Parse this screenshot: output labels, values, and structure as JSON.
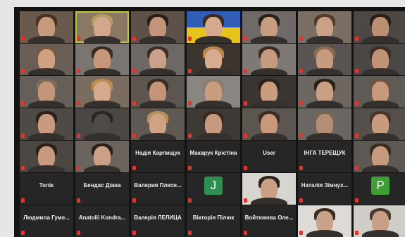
{
  "meeting": {
    "rows": [
      [
        {
          "kind": "video",
          "label": "",
          "skin": "#c49a7b",
          "hair": "#4a3023",
          "bg": "#6a5a4e",
          "active": false
        },
        {
          "kind": "video",
          "label": "",
          "skin": "#d2a88d",
          "hair": "#b59a63",
          "bg": "#8a7862",
          "active": true
        },
        {
          "kind": "video",
          "label": "",
          "skin": "#c39479",
          "hair": "#2b1e18",
          "bg": "#5d5149",
          "active": false
        },
        {
          "kind": "flag",
          "label": "",
          "skin": "#d4a990",
          "hair": "#3a2a22",
          "bg": "#2f5db7",
          "active": false
        },
        {
          "kind": "video",
          "label": "",
          "skin": "#c79c80",
          "hair": "#2a201b",
          "bg": "#6f6a67",
          "active": false
        },
        {
          "kind": "video",
          "label": "",
          "skin": "#caa088",
          "hair": "#55392a",
          "bg": "#7b6f63",
          "active": false
        },
        {
          "kind": "video",
          "label": "",
          "skin": "#bc8f73",
          "hair": "#2a2019",
          "bg": "#4e4844",
          "active": false
        }
      ],
      [
        {
          "kind": "video",
          "label": "",
          "skin": "#d0a083",
          "hair": "#7a5a3f",
          "bg": "#6a5f58",
          "active": false
        },
        {
          "kind": "video",
          "label": "",
          "skin": "#c8977b",
          "hair": "#3a2b22",
          "bg": "#7a7570",
          "active": false
        },
        {
          "kind": "video",
          "label": "",
          "skin": "#caa08a",
          "hair": "#3d2d24",
          "bg": "#6d6864",
          "active": false
        },
        {
          "kind": "video",
          "label": "",
          "skin": "#d6ab8f",
          "hair": "#b8864b",
          "bg": "#3c342e",
          "active": false
        },
        {
          "kind": "video",
          "label": "",
          "skin": "#c59a7e",
          "hair": "#3b2c23",
          "bg": "#7e7975",
          "active": false
        },
        {
          "kind": "video",
          "label": "",
          "skin": "#c69b80",
          "hair": "#8b6c53",
          "bg": "#5a5552",
          "active": false
        },
        {
          "kind": "video",
          "label": "",
          "skin": "#c19276",
          "hair": "#3d2d24",
          "bg": "#4a4744",
          "active": false
        }
      ],
      [
        {
          "kind": "video",
          "label": "",
          "skin": "#c49679",
          "hair": "#7c6a5b",
          "bg": "#665e58",
          "active": false
        },
        {
          "kind": "video",
          "label": "",
          "skin": "#d5a98b",
          "hair": "#c08b4f",
          "bg": "#7a6d60",
          "active": false
        },
        {
          "kind": "video",
          "label": "",
          "skin": "#c39478",
          "hair": "#3a2b22",
          "bg": "#5c5550",
          "active": false
        },
        {
          "kind": "video",
          "label": "",
          "skin": "#c99d80",
          "hair": "#8a7d70",
          "bg": "#8a8580",
          "active": false
        },
        {
          "kind": "video",
          "label": "",
          "skin": "#cc9c7f",
          "hair": "#2d211b",
          "bg": "#3a3532",
          "active": false
        },
        {
          "kind": "video",
          "label": "",
          "skin": "#caa084",
          "hair": "#2a1f19",
          "bg": "#6d6661",
          "active": false
        },
        {
          "kind": "video",
          "label": "",
          "skin": "#c8997b",
          "hair": "#6e5542",
          "bg": "#5e5a56",
          "active": false
        }
      ],
      [
        {
          "kind": "video",
          "label": "",
          "skin": "#c89b7f",
          "hair": "#2c211b",
          "bg": "#4f4a46",
          "active": false
        },
        {
          "kind": "video",
          "label": "",
          "skin": "#4f4b48",
          "hair": "#2a2623",
          "bg": "#4a4744",
          "active": false
        },
        {
          "kind": "video",
          "label": "",
          "skin": "#cfa286",
          "hair": "#b6905f",
          "bg": "#5f5853",
          "active": false
        },
        {
          "kind": "video",
          "label": "",
          "skin": "#c69a7e",
          "hair": "#3a2b22",
          "bg": "#3e3935",
          "active": false
        },
        {
          "kind": "video",
          "label": "",
          "skin": "#c9987b",
          "hair": "#3c2c23",
          "bg": "#5c5550",
          "active": false
        },
        {
          "kind": "video",
          "label": "",
          "skin": "#b48e74",
          "hair": "#776656",
          "bg": "#6b6661",
          "active": false
        },
        {
          "kind": "video",
          "label": "",
          "skin": "#c89a7e",
          "hair": "#4a3629",
          "bg": "#55504c",
          "active": false
        }
      ],
      [
        {
          "kind": "video",
          "label": "",
          "skin": "#c79b7f",
          "hair": "#2c201a",
          "bg": "#4c4642",
          "active": false
        },
        {
          "kind": "video",
          "label": "",
          "skin": "#caa086",
          "hair": "#2c221c",
          "bg": "#6a635e",
          "active": false
        },
        {
          "kind": "name",
          "label": "Надія Карпищук",
          "active": false
        },
        {
          "kind": "name",
          "label": "Макарук Крістіна",
          "active": false
        },
        {
          "kind": "name",
          "label": "User",
          "active": false
        },
        {
          "kind": "name",
          "label": "ІНГА ТЕРЕЩУК",
          "active": false
        },
        {
          "kind": "video",
          "label": "",
          "skin": "#c59a7f",
          "hair": "#3c2b22",
          "bg": "#5d5854",
          "active": false
        }
      ],
      [
        {
          "kind": "name",
          "label": "Толік",
          "active": false
        },
        {
          "kind": "name",
          "label": "Бендас Діана",
          "active": false
        },
        {
          "kind": "name",
          "label": "Валерия Плесн...",
          "active": false
        },
        {
          "kind": "initial",
          "label": "J",
          "color": "#2f8f51",
          "active": false
        },
        {
          "kind": "photo",
          "label": "",
          "skin": "#c9a086",
          "hair": "#2c221c",
          "bg": "#d8d4cf",
          "active": false
        },
        {
          "kind": "name",
          "label": "Наталія Зімнух...",
          "active": false
        },
        {
          "kind": "initial",
          "label": "P",
          "color": "#3e9e34",
          "active": false
        }
      ],
      [
        {
          "kind": "name",
          "label": "Людмила Гуме...",
          "active": false
        },
        {
          "kind": "name",
          "label": "Anatolii Kondra...",
          "active": false
        },
        {
          "kind": "name",
          "label": "Валерія ЛЕЛИЦА",
          "active": false
        },
        {
          "kind": "name",
          "label": "Вікторія Пілюк",
          "active": false
        },
        {
          "kind": "name",
          "label": "Войтюкова Оле...",
          "active": false
        },
        {
          "kind": "photo",
          "label": "",
          "skin": "#caa28a",
          "hair": "#3b2c24",
          "bg": "#dedad6",
          "active": false
        },
        {
          "kind": "photo",
          "label": "",
          "skin": "#c69f85",
          "hair": "#4a3a2e",
          "bg": "#d0ccc7",
          "active": false
        }
      ]
    ]
  }
}
